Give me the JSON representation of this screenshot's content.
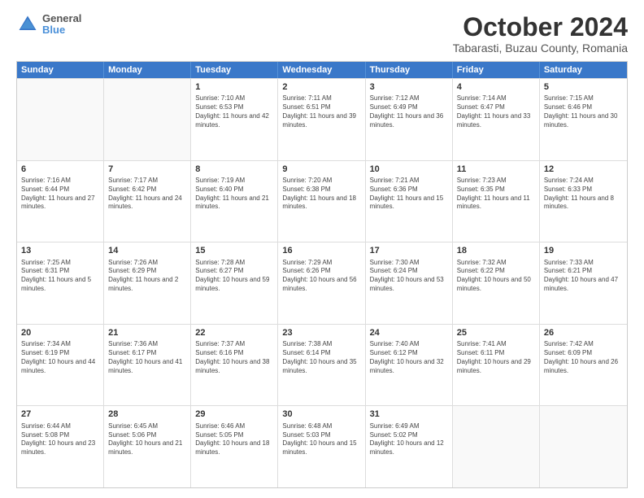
{
  "logo": {
    "line1": "General",
    "line2": "Blue"
  },
  "header": {
    "month": "October 2024",
    "location": "Tabarasti, Buzau County, Romania"
  },
  "days": [
    "Sunday",
    "Monday",
    "Tuesday",
    "Wednesday",
    "Thursday",
    "Friday",
    "Saturday"
  ],
  "rows": [
    [
      {
        "day": "",
        "info": ""
      },
      {
        "day": "",
        "info": ""
      },
      {
        "day": "1",
        "info": "Sunrise: 7:10 AM\nSunset: 6:53 PM\nDaylight: 11 hours and 42 minutes."
      },
      {
        "day": "2",
        "info": "Sunrise: 7:11 AM\nSunset: 6:51 PM\nDaylight: 11 hours and 39 minutes."
      },
      {
        "day": "3",
        "info": "Sunrise: 7:12 AM\nSunset: 6:49 PM\nDaylight: 11 hours and 36 minutes."
      },
      {
        "day": "4",
        "info": "Sunrise: 7:14 AM\nSunset: 6:47 PM\nDaylight: 11 hours and 33 minutes."
      },
      {
        "day": "5",
        "info": "Sunrise: 7:15 AM\nSunset: 6:46 PM\nDaylight: 11 hours and 30 minutes."
      }
    ],
    [
      {
        "day": "6",
        "info": "Sunrise: 7:16 AM\nSunset: 6:44 PM\nDaylight: 11 hours and 27 minutes."
      },
      {
        "day": "7",
        "info": "Sunrise: 7:17 AM\nSunset: 6:42 PM\nDaylight: 11 hours and 24 minutes."
      },
      {
        "day": "8",
        "info": "Sunrise: 7:19 AM\nSunset: 6:40 PM\nDaylight: 11 hours and 21 minutes."
      },
      {
        "day": "9",
        "info": "Sunrise: 7:20 AM\nSunset: 6:38 PM\nDaylight: 11 hours and 18 minutes."
      },
      {
        "day": "10",
        "info": "Sunrise: 7:21 AM\nSunset: 6:36 PM\nDaylight: 11 hours and 15 minutes."
      },
      {
        "day": "11",
        "info": "Sunrise: 7:23 AM\nSunset: 6:35 PM\nDaylight: 11 hours and 11 minutes."
      },
      {
        "day": "12",
        "info": "Sunrise: 7:24 AM\nSunset: 6:33 PM\nDaylight: 11 hours and 8 minutes."
      }
    ],
    [
      {
        "day": "13",
        "info": "Sunrise: 7:25 AM\nSunset: 6:31 PM\nDaylight: 11 hours and 5 minutes."
      },
      {
        "day": "14",
        "info": "Sunrise: 7:26 AM\nSunset: 6:29 PM\nDaylight: 11 hours and 2 minutes."
      },
      {
        "day": "15",
        "info": "Sunrise: 7:28 AM\nSunset: 6:27 PM\nDaylight: 10 hours and 59 minutes."
      },
      {
        "day": "16",
        "info": "Sunrise: 7:29 AM\nSunset: 6:26 PM\nDaylight: 10 hours and 56 minutes."
      },
      {
        "day": "17",
        "info": "Sunrise: 7:30 AM\nSunset: 6:24 PM\nDaylight: 10 hours and 53 minutes."
      },
      {
        "day": "18",
        "info": "Sunrise: 7:32 AM\nSunset: 6:22 PM\nDaylight: 10 hours and 50 minutes."
      },
      {
        "day": "19",
        "info": "Sunrise: 7:33 AM\nSunset: 6:21 PM\nDaylight: 10 hours and 47 minutes."
      }
    ],
    [
      {
        "day": "20",
        "info": "Sunrise: 7:34 AM\nSunset: 6:19 PM\nDaylight: 10 hours and 44 minutes."
      },
      {
        "day": "21",
        "info": "Sunrise: 7:36 AM\nSunset: 6:17 PM\nDaylight: 10 hours and 41 minutes."
      },
      {
        "day": "22",
        "info": "Sunrise: 7:37 AM\nSunset: 6:16 PM\nDaylight: 10 hours and 38 minutes."
      },
      {
        "day": "23",
        "info": "Sunrise: 7:38 AM\nSunset: 6:14 PM\nDaylight: 10 hours and 35 minutes."
      },
      {
        "day": "24",
        "info": "Sunrise: 7:40 AM\nSunset: 6:12 PM\nDaylight: 10 hours and 32 minutes."
      },
      {
        "day": "25",
        "info": "Sunrise: 7:41 AM\nSunset: 6:11 PM\nDaylight: 10 hours and 29 minutes."
      },
      {
        "day": "26",
        "info": "Sunrise: 7:42 AM\nSunset: 6:09 PM\nDaylight: 10 hours and 26 minutes."
      }
    ],
    [
      {
        "day": "27",
        "info": "Sunrise: 6:44 AM\nSunset: 5:08 PM\nDaylight: 10 hours and 23 minutes."
      },
      {
        "day": "28",
        "info": "Sunrise: 6:45 AM\nSunset: 5:06 PM\nDaylight: 10 hours and 21 minutes."
      },
      {
        "day": "29",
        "info": "Sunrise: 6:46 AM\nSunset: 5:05 PM\nDaylight: 10 hours and 18 minutes."
      },
      {
        "day": "30",
        "info": "Sunrise: 6:48 AM\nSunset: 5:03 PM\nDaylight: 10 hours and 15 minutes."
      },
      {
        "day": "31",
        "info": "Sunrise: 6:49 AM\nSunset: 5:02 PM\nDaylight: 10 hours and 12 minutes."
      },
      {
        "day": "",
        "info": ""
      },
      {
        "day": "",
        "info": ""
      }
    ]
  ]
}
